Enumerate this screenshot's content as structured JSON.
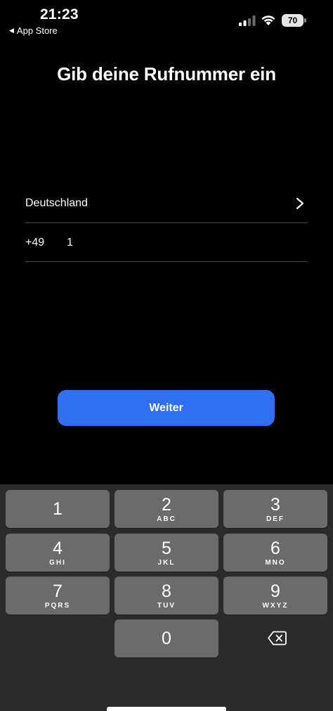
{
  "status_bar": {
    "time": "21:23",
    "back_app_label": "App Store",
    "battery_level": "70"
  },
  "page_title": "Gib deine Rufnummer ein",
  "country": {
    "label": "Deutschland"
  },
  "phone": {
    "country_code": "+49",
    "number_value": "1"
  },
  "continue_button": {
    "label": "Weiter",
    "color": "#2f6ff0"
  },
  "keypad": {
    "keys": [
      {
        "digit": "1",
        "letters": ""
      },
      {
        "digit": "2",
        "letters": "ABC"
      },
      {
        "digit": "3",
        "letters": "DEF"
      },
      {
        "digit": "4",
        "letters": "GHI"
      },
      {
        "digit": "5",
        "letters": "JKL"
      },
      {
        "digit": "6",
        "letters": "MNO"
      },
      {
        "digit": "7",
        "letters": "PQRS"
      },
      {
        "digit": "8",
        "letters": "TUV"
      },
      {
        "digit": "9",
        "letters": "WXYZ"
      },
      {
        "digit": "0",
        "letters": ""
      }
    ],
    "backspace_icon": "delete-left-icon"
  }
}
